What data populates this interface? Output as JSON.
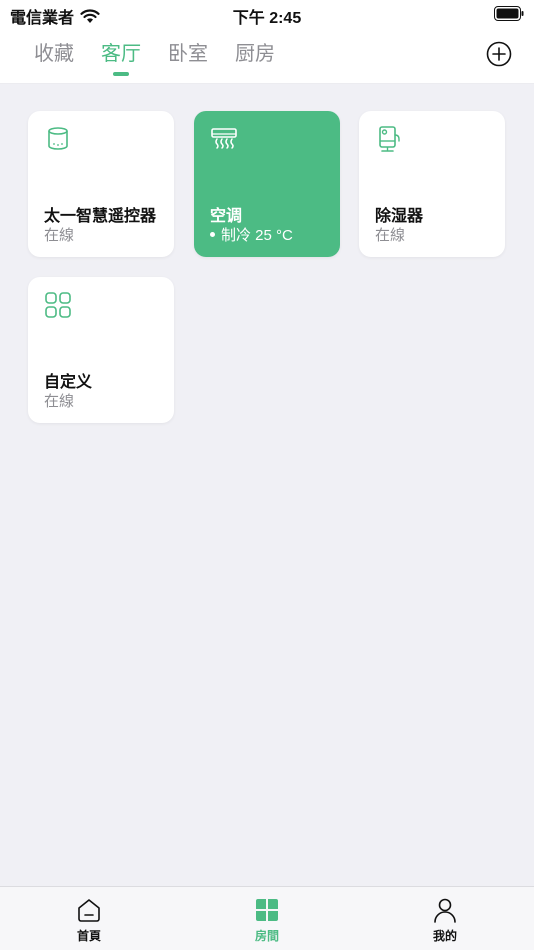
{
  "status_bar": {
    "carrier": "電信業者",
    "time": "下午 2:45"
  },
  "top_tabs": [
    {
      "label": "收藏",
      "active": false
    },
    {
      "label": "客厅",
      "active": true
    },
    {
      "label": "卧室",
      "active": false
    },
    {
      "label": "厨房",
      "active": false
    }
  ],
  "devices": [
    {
      "name": "太一智慧遥控器",
      "status": "在線",
      "icon": "remote-icon",
      "active": false
    },
    {
      "name": "空调",
      "status": "制冷 25 °C",
      "icon": "air-conditioner-icon",
      "active": true
    },
    {
      "name": "除湿器",
      "status": "在線",
      "icon": "dehumidifier-icon",
      "active": false
    },
    {
      "name": "自定义",
      "status": "在線",
      "icon": "custom-grid-icon",
      "active": false
    }
  ],
  "bottom_tabs": [
    {
      "label": "首頁",
      "icon": "home-icon",
      "active": false
    },
    {
      "label": "房間",
      "icon": "rooms-icon",
      "active": true
    },
    {
      "label": "我的",
      "icon": "person-icon",
      "active": false
    }
  ],
  "colors": {
    "accent": "#4cbb84",
    "background": "#f0f0f5",
    "inactive_text": "#8e8e93"
  }
}
